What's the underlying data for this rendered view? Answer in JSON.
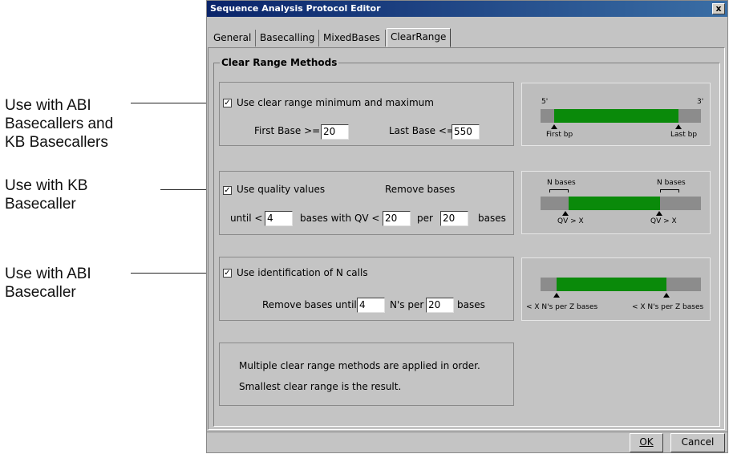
{
  "annotations": {
    "a1": [
      "Use with ABI",
      "Basecallers and",
      "KB Basecallers"
    ],
    "a2": [
      "Use with KB",
      "Basecaller"
    ],
    "a3": [
      "Use with ABI",
      "Basecaller"
    ]
  },
  "dialog": {
    "title": "Sequence Analysis Protocol Editor",
    "close_glyph": "x",
    "tabs": [
      "General",
      "Basecalling",
      "MixedBases",
      "ClearRange"
    ],
    "active_tab": "ClearRange",
    "section_title": "Clear Range Methods"
  },
  "method1": {
    "checked": true,
    "label": "Use clear range minimum and maximum",
    "first_base_label": "First Base >=",
    "first_base_value": "20",
    "last_base_label": "Last Base <=",
    "last_base_value": "550",
    "diagram": {
      "left_end": "5'",
      "right_end": "3'",
      "left_marker": "First bp",
      "right_marker": "Last bp"
    }
  },
  "method2": {
    "checked": true,
    "label": "Use quality values",
    "remove_label": "Remove bases",
    "until_label": "until <",
    "until_value": "4",
    "qv_label": "bases with QV <",
    "qv_value": "20",
    "per_label": "per",
    "per_value": "20",
    "bases_label": "bases",
    "diagram": {
      "left_top": "N bases",
      "right_top": "N bases",
      "left_marker": "QV > X",
      "right_marker": "QV > X"
    }
  },
  "method3": {
    "checked": true,
    "label": "Use identification of N calls",
    "remove_label": "Remove bases until <",
    "until_value": "4",
    "nper_label": "N's per",
    "nper_value": "20",
    "bases_label": "bases",
    "diagram": {
      "left_marker": "< X N's per Z bases",
      "right_marker": "< X N's per Z bases"
    }
  },
  "note": {
    "line1": "Multiple clear range methods are applied in order.",
    "line2": "Smallest clear range is the result."
  },
  "buttons": {
    "ok": "OK",
    "cancel": "Cancel"
  },
  "colors": {
    "green_bar": "#0a8a0a",
    "grey_bar": "#8c8c8c",
    "title_bar": "#0a246a"
  }
}
